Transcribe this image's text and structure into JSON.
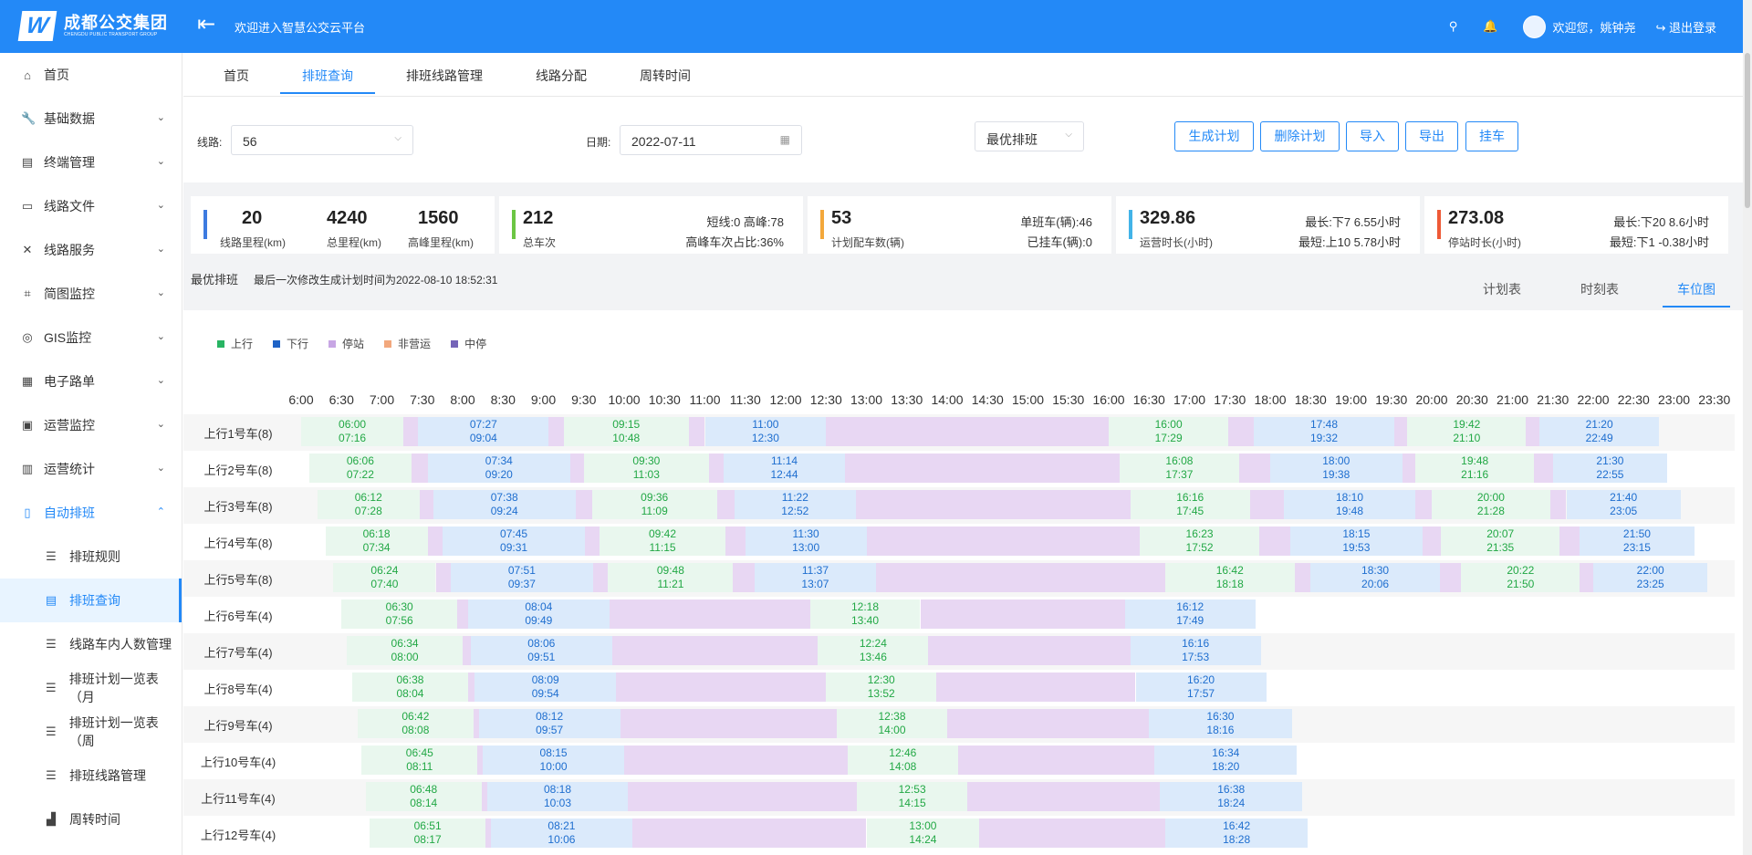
{
  "header": {
    "logo_mark": "W",
    "brand": "成都公交集团",
    "brand_en": "CHENGDU PUBLIC TRANSPORT GROUP",
    "welcome": "欢迎进入智慧公交云平台",
    "user_greeting": "欢迎您，姚钟尧",
    "logout": "退出登录",
    "icons": [
      "menu-toggle-icon",
      "search-icon",
      "bell-icon",
      "avatar",
      "logout-icon"
    ]
  },
  "sidebar": {
    "items": [
      {
        "label": "首页",
        "icon": "home-icon"
      },
      {
        "label": "基础数据",
        "icon": "wrench-icon"
      },
      {
        "label": "终端管理",
        "icon": "document-icon"
      },
      {
        "label": "线路文件",
        "icon": "folder-icon"
      },
      {
        "label": "线路服务",
        "icon": "service-icon"
      },
      {
        "label": "简图监控",
        "icon": "monitor-icon"
      },
      {
        "label": "GIS监控",
        "icon": "gis-icon"
      },
      {
        "label": "电子路单",
        "icon": "table-icon"
      },
      {
        "label": "运营监控",
        "icon": "report-icon"
      },
      {
        "label": "运营统计",
        "icon": "stats-icon"
      },
      {
        "label": "自动排班",
        "icon": "schedule-icon"
      }
    ],
    "sub_items": [
      {
        "label": "排班规则",
        "icon": "list-icon"
      },
      {
        "label": "排班查询",
        "icon": "search-doc-icon",
        "active": true
      },
      {
        "label": "线路车内人数管理",
        "icon": "list-icon"
      },
      {
        "label": "排班计划一览表（月",
        "icon": "list-icon"
      },
      {
        "label": "排班计划一览表（周",
        "icon": "list-icon"
      },
      {
        "label": "排班线路管理",
        "icon": "list-icon"
      },
      {
        "label": "周转时间",
        "icon": "chart-icon"
      }
    ]
  },
  "tabs": [
    "首页",
    "排班查询",
    "排班线路管理",
    "线路分配",
    "周转时间"
  ],
  "active_tab": "排班查询",
  "filters": {
    "line_label": "线路:",
    "line_value": "56",
    "date_label": "日期:",
    "date_value": "2022-07-11",
    "mode_value": "最优排班",
    "buttons": [
      "生成计划",
      "删除计划",
      "导入",
      "导出",
      "挂车"
    ]
  },
  "summary": {
    "route_km": "20",
    "route_km_label": "线路里程(km)",
    "total_km": "4240",
    "total_km_label": "总里程(km)",
    "peak_km": "1560",
    "peak_km_label": "高峰里程(km)",
    "total_trips": "212",
    "total_trips_label": "总车次",
    "trip_info1": "短线:0 高峰:78",
    "trip_info2": "高峰车次占比:36%",
    "vehicles": "53",
    "vehicles_label": "计划配车数(辆)",
    "veh_info1": "单班车(辆):46",
    "veh_info2": "已挂车(辆):0",
    "run_hours": "329.86",
    "run_hours_label": "运营时长(小时)",
    "run_info1": "最长:下7 6.55小时",
    "run_info2": "最短:上10 5.78小时",
    "stop_hours": "273.08",
    "stop_hours_label": "停站时长(小时)",
    "stop_info1": "最长:下20 8.6小时",
    "stop_info2": "最短:下1 -0.38小时",
    "card_colors": [
      "#3d7be0",
      "#6cc644",
      "#f3a83b",
      "#42b3e8",
      "#ee5a37"
    ]
  },
  "optimal": {
    "title": "最优排班",
    "subtitle": "最后一次修改生成计划时间为2022-08-10 18:52:31"
  },
  "view_tabs": [
    "计划表",
    "时刻表",
    "车位图"
  ],
  "active_view": "车位图",
  "legend": [
    {
      "label": "上行",
      "color": "#28b463"
    },
    {
      "label": "下行",
      "color": "#1f63c6"
    },
    {
      "label": "停站",
      "color": "#c7a6e4"
    },
    {
      "label": "非营运",
      "color": "#f2a87d"
    },
    {
      "label": "中停",
      "color": "#7565b8"
    }
  ],
  "time_ticks": [
    "6:00",
    "6:30",
    "7:00",
    "7:30",
    "8:00",
    "8:30",
    "9:00",
    "9:30",
    "10:00",
    "10:30",
    "11:00",
    "11:30",
    "12:00",
    "12:30",
    "13:00",
    "13:30",
    "14:00",
    "14:30",
    "15:00",
    "15:30",
    "16:00",
    "16:30",
    "17:00",
    "17:30",
    "18:00",
    "18:30",
    "19:00",
    "19:30",
    "20:00",
    "20:30",
    "21:00",
    "21:30",
    "22:00",
    "22:30",
    "23:00",
    "23:30"
  ],
  "vehicles": [
    {
      "label": "上行1号车(8)",
      "trips": [
        [
          "06:00",
          "07:16",
          "up"
        ],
        [
          "07:27",
          "09:04",
          "down"
        ],
        [
          "09:15",
          "10:48",
          "up"
        ],
        [
          "11:00",
          "12:30",
          "down"
        ],
        [
          "16:00",
          "17:29",
          "up"
        ],
        [
          "17:48",
          "19:32",
          "down"
        ],
        [
          "19:42",
          "21:10",
          "up"
        ],
        [
          "21:20",
          "22:49",
          "down"
        ]
      ]
    },
    {
      "label": "上行2号车(8)",
      "trips": [
        [
          "06:06",
          "07:22",
          "up"
        ],
        [
          "07:34",
          "09:20",
          "down"
        ],
        [
          "09:30",
          "11:03",
          "up"
        ],
        [
          "11:14",
          "12:44",
          "down"
        ],
        [
          "16:08",
          "17:37",
          "up"
        ],
        [
          "18:00",
          "19:38",
          "down"
        ],
        [
          "19:48",
          "21:16",
          "up"
        ],
        [
          "21:30",
          "22:55",
          "down"
        ]
      ]
    },
    {
      "label": "上行3号车(8)",
      "trips": [
        [
          "06:12",
          "07:28",
          "up"
        ],
        [
          "07:38",
          "09:24",
          "down"
        ],
        [
          "09:36",
          "11:09",
          "up"
        ],
        [
          "11:22",
          "12:52",
          "down"
        ],
        [
          "16:16",
          "17:45",
          "up"
        ],
        [
          "18:10",
          "19:48",
          "down"
        ],
        [
          "20:00",
          "21:28",
          "up"
        ],
        [
          "21:40",
          "23:05",
          "down"
        ]
      ]
    },
    {
      "label": "上行4号车(8)",
      "trips": [
        [
          "06:18",
          "07:34",
          "up"
        ],
        [
          "07:45",
          "09:31",
          "down"
        ],
        [
          "09:42",
          "11:15",
          "up"
        ],
        [
          "11:30",
          "13:00",
          "down"
        ],
        [
          "16:23",
          "17:52",
          "up"
        ],
        [
          "18:15",
          "19:53",
          "down"
        ],
        [
          "20:07",
          "21:35",
          "up"
        ],
        [
          "21:50",
          "23:15",
          "down"
        ]
      ]
    },
    {
      "label": "上行5号车(8)",
      "trips": [
        [
          "06:24",
          "07:40",
          "up"
        ],
        [
          "07:51",
          "09:37",
          "down"
        ],
        [
          "09:48",
          "11:21",
          "up"
        ],
        [
          "11:37",
          "13:07",
          "down"
        ],
        [
          "16:42",
          "18:18",
          "up"
        ],
        [
          "18:30",
          "20:06",
          "down"
        ],
        [
          "20:22",
          "21:50",
          "up"
        ],
        [
          "22:00",
          "23:25",
          "down"
        ]
      ]
    },
    {
      "label": "上行6号车(4)",
      "trips": [
        [
          "06:30",
          "07:56",
          "up"
        ],
        [
          "08:04",
          "09:49",
          "down"
        ],
        [
          "12:18",
          "13:40",
          "up"
        ],
        [
          "16:12",
          "17:49",
          "down"
        ]
      ]
    },
    {
      "label": "上行7号车(4)",
      "trips": [
        [
          "06:34",
          "08:00",
          "up"
        ],
        [
          "08:06",
          "09:51",
          "down"
        ],
        [
          "12:24",
          "13:46",
          "up"
        ],
        [
          "16:16",
          "17:53",
          "down"
        ]
      ]
    },
    {
      "label": "上行8号车(4)",
      "trips": [
        [
          "06:38",
          "08:04",
          "up"
        ],
        [
          "08:09",
          "09:54",
          "down"
        ],
        [
          "12:30",
          "13:52",
          "up"
        ],
        [
          "16:20",
          "17:57",
          "down"
        ]
      ]
    },
    {
      "label": "上行9号车(4)",
      "trips": [
        [
          "06:42",
          "08:08",
          "up"
        ],
        [
          "08:12",
          "09:57",
          "down"
        ],
        [
          "12:38",
          "14:00",
          "up"
        ],
        [
          "16:30",
          "18:16",
          "down"
        ]
      ]
    },
    {
      "label": "上行10号车(4)",
      "trips": [
        [
          "06:45",
          "08:11",
          "up"
        ],
        [
          "08:15",
          "10:00",
          "down"
        ],
        [
          "12:46",
          "14:08",
          "up"
        ],
        [
          "16:34",
          "18:20",
          "down"
        ]
      ]
    },
    {
      "label": "上行11号车(4)",
      "trips": [
        [
          "06:48",
          "08:14",
          "up"
        ],
        [
          "08:18",
          "10:03",
          "down"
        ],
        [
          "12:53",
          "14:15",
          "up"
        ],
        [
          "16:38",
          "18:24",
          "down"
        ]
      ]
    },
    {
      "label": "上行12号车(4)",
      "trips": [
        [
          "06:51",
          "08:17",
          "up"
        ],
        [
          "08:21",
          "10:06",
          "down"
        ],
        [
          "13:00",
          "14:24",
          "up"
        ],
        [
          "16:42",
          "18:28",
          "down"
        ]
      ]
    }
  ]
}
